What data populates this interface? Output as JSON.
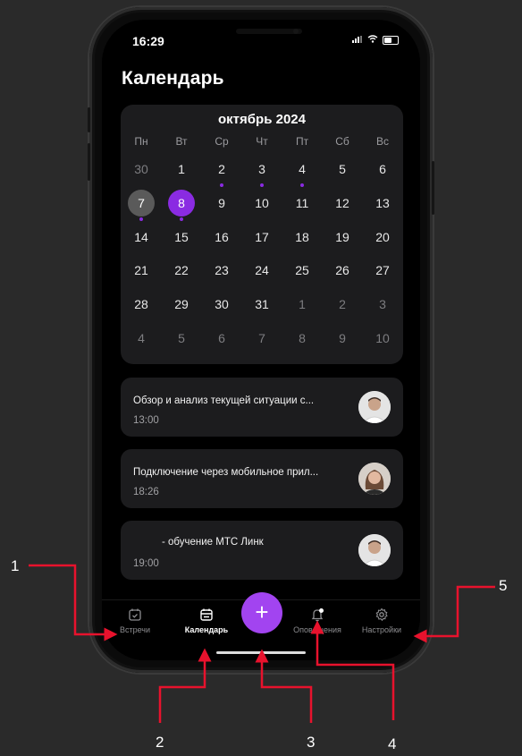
{
  "status_bar": {
    "time": "16:29",
    "signal": "..",
    "wifi": "≈"
  },
  "header": {
    "title": "Календарь"
  },
  "calendar": {
    "month": "октябрь 2024",
    "weekdays": [
      "Пн",
      "Вт",
      "Ср",
      "Чт",
      "Пт",
      "Сб",
      "Вс"
    ],
    "weeks": [
      [
        {
          "d": "30",
          "other": true
        },
        {
          "d": "1"
        },
        {
          "d": "2",
          "dot": true
        },
        {
          "d": "3",
          "dot": true
        },
        {
          "d": "4",
          "dot": true
        },
        {
          "d": "5"
        },
        {
          "d": "6"
        }
      ],
      [
        {
          "d": "7",
          "today": true,
          "dot": true
        },
        {
          "d": "8",
          "selected": true,
          "dot": true
        },
        {
          "d": "9"
        },
        {
          "d": "10"
        },
        {
          "d": "11"
        },
        {
          "d": "12"
        },
        {
          "d": "13"
        }
      ],
      [
        {
          "d": "14"
        },
        {
          "d": "15"
        },
        {
          "d": "16"
        },
        {
          "d": "17"
        },
        {
          "d": "18"
        },
        {
          "d": "19"
        },
        {
          "d": "20"
        }
      ],
      [
        {
          "d": "21"
        },
        {
          "d": "22"
        },
        {
          "d": "23"
        },
        {
          "d": "24"
        },
        {
          "d": "25"
        },
        {
          "d": "26"
        },
        {
          "d": "27"
        }
      ],
      [
        {
          "d": "28"
        },
        {
          "d": "29"
        },
        {
          "d": "30"
        },
        {
          "d": "31"
        },
        {
          "d": "1",
          "other": true
        },
        {
          "d": "2",
          "other": true
        },
        {
          "d": "3",
          "other": true
        }
      ],
      [
        {
          "d": "4",
          "other": true
        },
        {
          "d": "5",
          "other": true
        },
        {
          "d": "6",
          "other": true
        },
        {
          "d": "7",
          "other": true
        },
        {
          "d": "8",
          "other": true
        },
        {
          "d": "9",
          "other": true
        },
        {
          "d": "10",
          "other": true
        }
      ]
    ]
  },
  "events": [
    {
      "title": "Обзор и анализ текущей ситуации с...",
      "time": "13:00",
      "avatar": "man-avatar"
    },
    {
      "title": "Подключение через мобильное прил...",
      "time": "18:26",
      "avatar": "woman-avatar"
    },
    {
      "title": "- обучение МТС Линк",
      "time": "19:00",
      "avatar": "man-avatar"
    }
  ],
  "tabbar": {
    "meetings": "Встречи",
    "calendar": "Календарь",
    "add": "+",
    "notifications": "Оповещения",
    "settings": "Настройки"
  },
  "callouts": [
    "1",
    "2",
    "3",
    "4",
    "5"
  ],
  "colors": {
    "accent": "#8a2be2",
    "fab": "#a244f0",
    "arrow": "#e8122d",
    "background": "#2a2a2a"
  }
}
